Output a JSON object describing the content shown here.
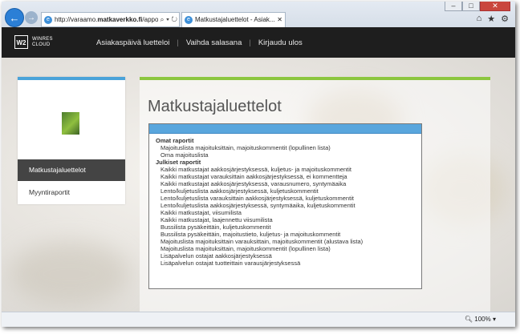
{
  "browser": {
    "url_prefix": "http://varaamo.",
    "url_domain": "matkaverkko.fi",
    "url_suffix": "/appor",
    "tab_title": "Matkustajaluettelot - Asiak..."
  },
  "logo": {
    "mark": "W2",
    "line1": "WINRES",
    "line2": "CLOUD"
  },
  "nav": {
    "items": [
      "Asiakaspäivä luetteloi",
      "Vaihda salasana",
      "Kirjaudu ulos"
    ]
  },
  "sidebar": {
    "active": "Matkustajaluettelot",
    "item": "Myyntiraportit"
  },
  "main": {
    "title": "Matkustajaluettelot"
  },
  "dropdown": {
    "groups": [
      {
        "label": "Omat raportit",
        "options": [
          "Majoituslista majoituksittain, majoituskommentit (lopullinen lista)",
          "Oma majoituslista"
        ]
      },
      {
        "label": "Julkiset raportit",
        "options": [
          "Kaikki matkustajat aakkosjärjestyksessä, kuljetus- ja majoituskommentit",
          "Kaikki matkustajat varauksittain aakkosjärjestyksessä, ei kommentteja",
          "Kaikki matkustajat aakkosjärjestyksessä, varausnumero, syntymäaika",
          "Lento/kuljetuslista aakkosjärjestyksessä, kuljetuskommentit",
          "Lento/kuljetuslista varauksittain aakkosjärjestyksessä, kuljetuskommentit",
          "Lento/kuljetuslista aakkosjärjestyksessä, syntymäaika, kuljetuskommentit",
          "Kaikki matkustajat, viisumilista",
          "Kaikki matkustajat, laajennettu viisumilista",
          "Bussilista pysäkeittäin, kuljetuskommentit",
          "Bussilista pysäkeittäin, majoitustieto, kuljetus- ja majoituskommentit",
          "Majoituslista majoituksittain varauksittain, majoituskommentit (alustava lista)",
          "Majoituslista majoituksittain, majoituskommentit (lopullinen lista)",
          "Lisäpalvelun ostajat aakkosjärjestyksessä",
          "Lisäpalvelun ostajat tuotteittain varausjärjestyksessä"
        ]
      }
    ]
  },
  "status": {
    "zoom": "100%"
  },
  "icons": {
    "back": "back-arrow-icon",
    "forward": "forward-arrow-icon",
    "home": "home-icon",
    "favorites": "star-icon",
    "settings": "gear-icon"
  }
}
